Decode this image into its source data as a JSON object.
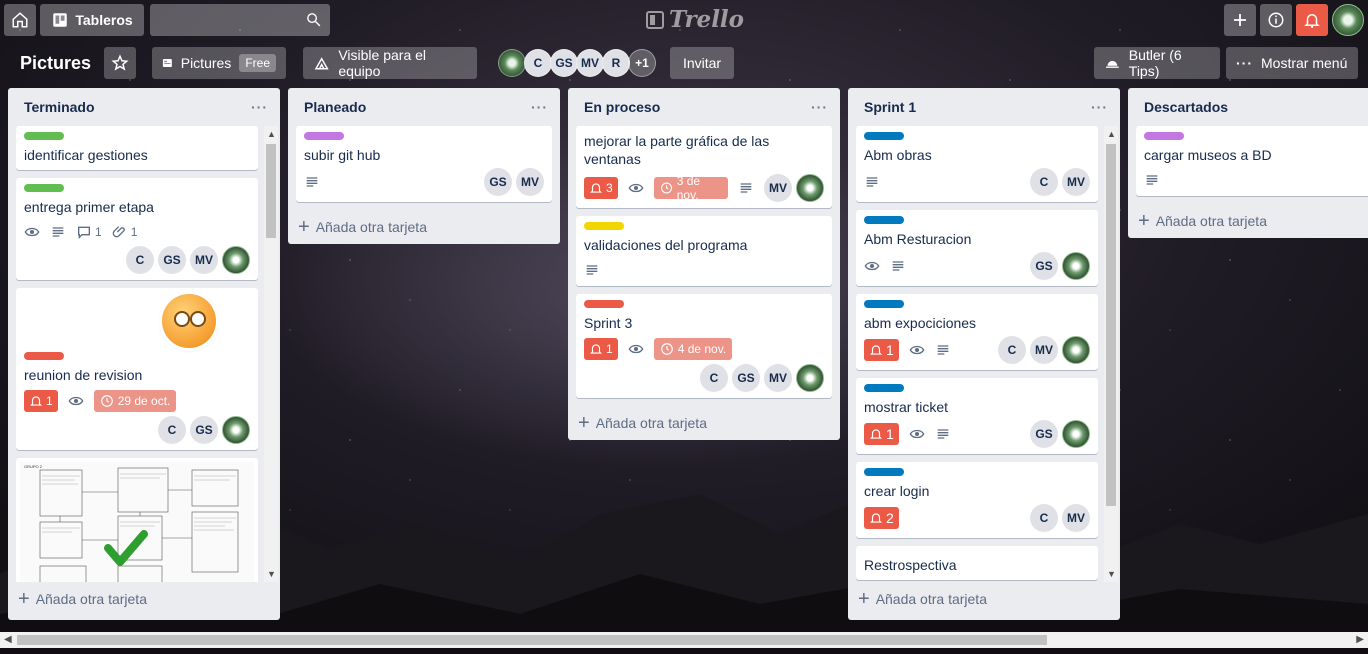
{
  "topbar": {
    "boards_label": "Tableros",
    "logo_text": "Trello"
  },
  "board": {
    "title": "Pictures",
    "pictures_label": "Pictures",
    "free_label": "Free",
    "visibility_label": "Visible para el equipo",
    "members": [
      "C",
      "GS",
      "MV",
      "R"
    ],
    "members_more": "+1",
    "invite_label": "Invitar",
    "butler_label": "Butler (6 Tips)",
    "menu_label": "Mostrar menú"
  },
  "add_card_label": "Añada otra tarjeta",
  "colors": {
    "green": "#61bd4f",
    "purple": "#c377e0",
    "red": "#eb5a46",
    "yellow": "#f2d600",
    "blue": "#0079bf"
  },
  "lists": [
    {
      "title": "Terminado",
      "cards": [
        {
          "title": "identificar gestiones",
          "label": "green"
        },
        {
          "title": "entrega primer etapa",
          "label": "green",
          "comments": "1",
          "attachments": "1",
          "members": [
            "C",
            "GS",
            "MV"
          ]
        },
        {
          "title": "reunion de revision",
          "label": "red",
          "notifications": "1",
          "due": "29 de oct.",
          "members": [
            "C",
            "GS"
          ]
        }
      ]
    },
    {
      "title": "Planeado",
      "cards": [
        {
          "title": "subir git hub",
          "label": "purple",
          "members": [
            "GS",
            "MV"
          ]
        }
      ]
    },
    {
      "title": "En proceso",
      "cards": [
        {
          "title": "mejorar la parte gráfica de las ventanas",
          "notifications": "3",
          "due": "3 de nov.",
          "members": [
            "MV"
          ]
        },
        {
          "title": "validaciones del programa",
          "label": "yellow"
        },
        {
          "title": "Sprint 3",
          "label": "red",
          "notifications": "1",
          "due": "4 de nov.",
          "members": [
            "C",
            "GS",
            "MV"
          ]
        }
      ]
    },
    {
      "title": "Sprint 1",
      "cards": [
        {
          "title": "Abm obras",
          "label": "blue",
          "members": [
            "C",
            "MV"
          ]
        },
        {
          "title": "Abm Resturacion",
          "label": "blue",
          "members": [
            "GS"
          ]
        },
        {
          "title": "abm expociciones",
          "label": "blue",
          "notifications": "1",
          "members": [
            "C",
            "MV"
          ]
        },
        {
          "title": "mostrar ticket",
          "label": "blue",
          "notifications": "1",
          "members": [
            "GS"
          ]
        },
        {
          "title": "crear login",
          "label": "blue",
          "notifications": "2",
          "members": [
            "C",
            "MV"
          ]
        },
        {
          "title": "Restrospectiva"
        }
      ]
    },
    {
      "title": "Descartados",
      "cards": [
        {
          "title": "cargar museos a BD",
          "label": "purple"
        }
      ]
    }
  ]
}
